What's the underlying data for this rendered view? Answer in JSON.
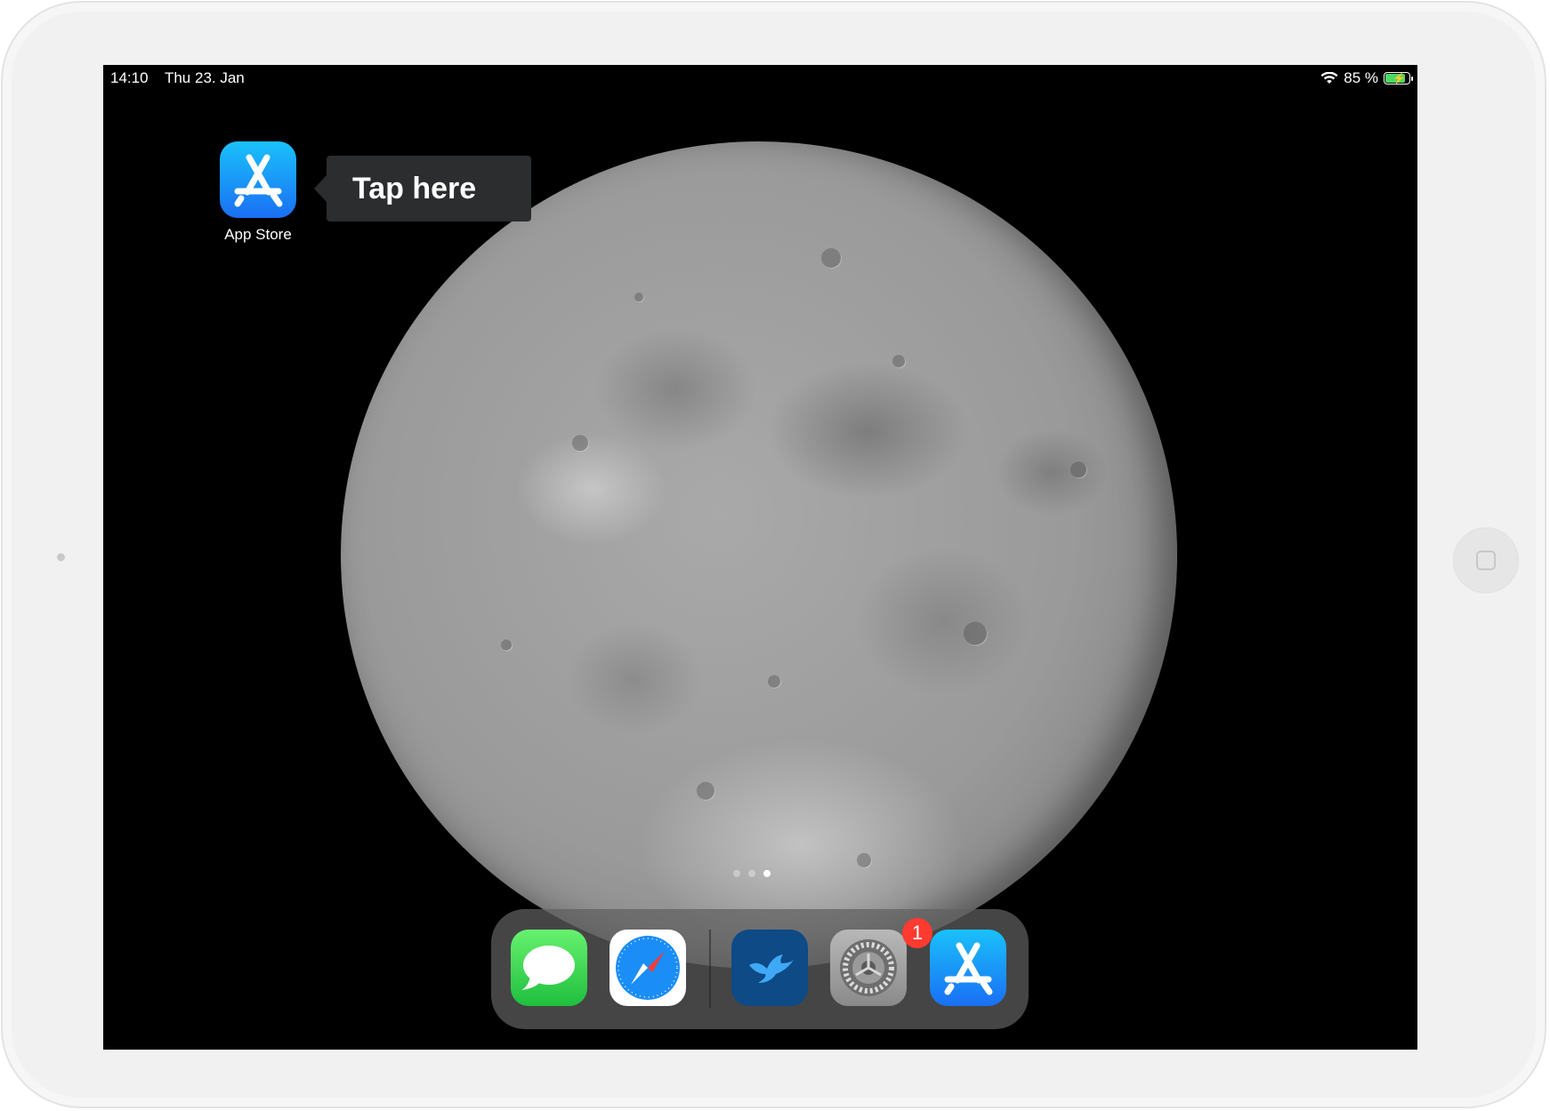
{
  "status_bar": {
    "time": "14:10",
    "date": "Thu 23. Jan",
    "battery_percent": "85 %",
    "battery_level": 0.85,
    "charging": true
  },
  "home_screen": {
    "apps": [
      {
        "label": "App Store",
        "icon": "app-store-icon"
      }
    ]
  },
  "tooltip": {
    "text": "Tap here"
  },
  "page_indicator": {
    "count": 3,
    "active_index": 2
  },
  "dock": {
    "apps": [
      {
        "icon": "messages-icon"
      },
      {
        "icon": "safari-icon"
      },
      {
        "icon": "bird-app-icon"
      },
      {
        "icon": "settings-icon",
        "badge": "1"
      },
      {
        "icon": "app-store-icon"
      }
    ]
  },
  "colors": {
    "badge": "#ff3b30",
    "battery_fill": "#4cd964",
    "app_store_blue": "#1a8df7",
    "tooltip_bg": "#2b2d2f"
  }
}
